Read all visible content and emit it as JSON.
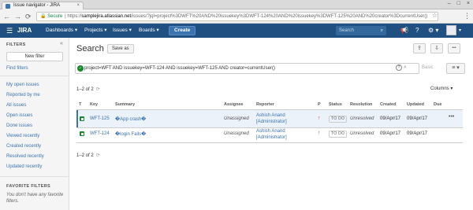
{
  "browser": {
    "tab_title": "Issue navigator - JIRA",
    "close_glyph": "×",
    "window_controls": [
      "–",
      "□",
      "×"
    ],
    "back_icon": "←",
    "forward_icon": "→",
    "reload_icon": "⟳",
    "lock_icon": "🔒",
    "secure_label": "Secure",
    "url_prefix": "| https://",
    "url_host": "samplejira.atlassian.net",
    "url_path": "/issues/?jql=project%3DWFT%20AND%20issuekey%3DWFT-124%20AND%20issuekey%3DWFT-125%20AND%20creator%3DcurrentUser()",
    "star_icon": "☆",
    "menu_icon": "⋮"
  },
  "topnav": {
    "menu_icon": "☰",
    "logo": "JIRA",
    "items": [
      "Dashboards ▾",
      "Projects ▾",
      "Issues ▾",
      "Boards ▾"
    ],
    "create_label": "Create",
    "search_placeholder": "Search",
    "search_icon": "⌕",
    "icons": {
      "feedback": "📢",
      "help": "?",
      "settings": "⚙ ▾",
      "profile_caret": "▾"
    }
  },
  "sidebar": {
    "header": "FILTERS",
    "collapse_icon": "«",
    "new_filter_label": "New filter",
    "find_filters": "Find filters",
    "filters": [
      "My open issues",
      "Reported by me",
      "All issues",
      "Open issues",
      "Done issues",
      "Viewed recently",
      "Created recently",
      "Resolved recently",
      "Updated recently"
    ],
    "favorites_header": "FAVORITE FILTERS",
    "favorites_empty": "You don't have any favorite filters."
  },
  "main": {
    "title": "Search",
    "save_as_label": "Save as",
    "toolbar_icons": {
      "share": "⇪",
      "export": "⇩",
      "more": "•••"
    },
    "jql_ok": "✓",
    "jql": "project=WFT AND issuekey=WFT-124 AND issuekey=WFT-125 AND creator=currentUser()",
    "help_icon": "?",
    "search_icon": "⌕",
    "basic_label": "Basic",
    "view_icon": "≡ ▾",
    "count_top": "1–2 of 2",
    "count_bottom": "1–2 of 2",
    "refresh_icon": "⟳",
    "columns_label": "Columns ▾",
    "row_menu_icon": "•••",
    "headers": {
      "type": "T",
      "key": "Key",
      "summary": "Summary",
      "assignee": "Assignee",
      "reporter": "Reporter",
      "priority": "P",
      "status": "Status",
      "resolution": "Resolution",
      "created": "Created",
      "updated": "Updated",
      "due": "Due"
    },
    "rows": [
      {
        "key": "WFT-125",
        "summary": "�App crash�",
        "assignee": "Unassigned",
        "reporter_name": "Ashish Anand",
        "reporter_role": "[Administrator]",
        "priority": "↑",
        "status": "TO DO",
        "resolution": "Unresolved",
        "created": "09/Apr/17",
        "updated": "09/Apr/17",
        "due": ""
      },
      {
        "key": "WFT-124",
        "summary": "�login Fails�",
        "assignee": "Unassigned",
        "reporter_name": "Ashish Anand",
        "reporter_role": "[Administrator]",
        "priority": "↑",
        "status": "TO DO",
        "resolution": "Unresolved",
        "created": "09/Apr/17",
        "updated": "09/Apr/17",
        "due": ""
      }
    ]
  }
}
